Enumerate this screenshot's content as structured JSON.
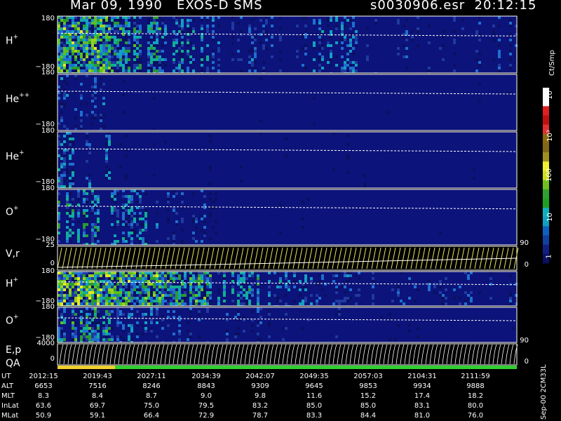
{
  "title_left": "Mar 09, 1990   EXOS-D SMS",
  "title_right": "s0030906.esr  20:12:15",
  "panels": [
    {
      "label": "H",
      "sup": "+",
      "top": "180",
      "bottom": "−180"
    },
    {
      "label": "He",
      "sup": "++",
      "top": "180",
      "bottom": "−180"
    },
    {
      "label": "He",
      "sup": "+",
      "top": "180",
      "bottom": "−180"
    },
    {
      "label": "O",
      "sup": "+",
      "top": "180",
      "bottom": "−180"
    },
    {
      "label": "V,r",
      "sup": "",
      "top": "25",
      "bottom": "0"
    },
    {
      "label": "H",
      "sup": "+",
      "top": "180",
      "bottom": "−180"
    },
    {
      "label": "O",
      "sup": "+",
      "top": "180",
      "bottom": "−180"
    },
    {
      "label": "E,p",
      "sup": "",
      "top": "4000",
      "bottom": "0"
    }
  ],
  "qa_label": "QA",
  "right_ticks": {
    "vr_top": "90",
    "vr_bottom": "0",
    "ep_top": "90",
    "ep_bottom": "0"
  },
  "colorbar": {
    "unit": "Ct/Smp",
    "labels": [
      "1",
      "10",
      "100",
      "10³",
      "10⁴"
    ]
  },
  "table": {
    "rows": [
      {
        "name": "UT",
        "values": [
          "2012:15",
          "2019:43",
          "2027:11",
          "2034:39",
          "2042:07",
          "2049:35",
          "2057:03",
          "2104:31",
          "2111:59"
        ]
      },
      {
        "name": "ALT",
        "values": [
          "6653",
          "7516",
          "8246",
          "8843",
          "9309",
          "9645",
          "9853",
          "9934",
          "9888"
        ]
      },
      {
        "name": "MLT",
        "values": [
          "8.3",
          "8.4",
          "8.7",
          "9.0",
          "9.8",
          "11.6",
          "15.2",
          "17.4",
          "18.2"
        ]
      },
      {
        "name": "InLat",
        "values": [
          "63.6",
          "69.7",
          "75.0",
          "79.5",
          "83.2",
          "85.0",
          "85.0",
          "83.1",
          "80.0"
        ]
      },
      {
        "name": "MLat",
        "values": [
          "50.9",
          "59.1",
          "66.4",
          "72.9",
          "78.7",
          "83.3",
          "84.4",
          "81.0",
          "76.0"
        ]
      }
    ]
  },
  "version": "Sep-00 2CM33L",
  "chart_data": {
    "type": "heatmap",
    "title": "Mar 09, 1990   EXOS-D SMS",
    "x_ticks": [
      "2012:15",
      "2019:43",
      "2027:11",
      "2034:39",
      "2042:07",
      "2049:35",
      "2057:03",
      "2104:31",
      "2111:59"
    ],
    "series": [
      {
        "name": "H+",
        "ylim": [
          -180,
          180
        ]
      },
      {
        "name": "He++",
        "ylim": [
          -180,
          180
        ]
      },
      {
        "name": "He+",
        "ylim": [
          -180,
          180
        ]
      },
      {
        "name": "O+",
        "ylim": [
          -180,
          180
        ]
      },
      {
        "name": "V,r",
        "ylim": [
          0,
          25
        ]
      },
      {
        "name": "H+",
        "ylim": [
          -180,
          180
        ]
      },
      {
        "name": "O+",
        "ylim": [
          -180,
          180
        ]
      },
      {
        "name": "E,p",
        "ylim": [
          0,
          4000
        ]
      }
    ],
    "colorbar_scale": "log",
    "colorbar_range": [
      1,
      10000
    ]
  }
}
